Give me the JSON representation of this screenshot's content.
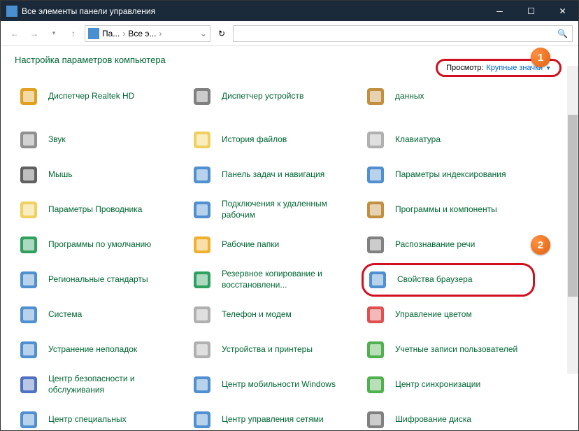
{
  "window": {
    "title": "Все элементы панели управления"
  },
  "breadcrumb": {
    "p1": "Па...",
    "p2": "Все э..."
  },
  "header": {
    "title": "Настройка параметров компьютера"
  },
  "viewby": {
    "label": "Просмотр:",
    "value": "Крупные значки"
  },
  "badges": {
    "one": "1",
    "two": "2"
  },
  "items": [
    {
      "label": "Диспетчер Realtek HD",
      "c": "#e0a020"
    },
    {
      "label": "Диспетчер устройств",
      "c": "#808080"
    },
    {
      "label": "данных",
      "c": "#c09040"
    },
    {
      "label": "Звук",
      "c": "#909090"
    },
    {
      "label": "История файлов",
      "c": "#f0d060"
    },
    {
      "label": "Клавиатура",
      "c": "#b0b0b0"
    },
    {
      "label": "Мышь",
      "c": "#606060"
    },
    {
      "label": "Панель задач и навигация",
      "c": "#5090d0"
    },
    {
      "label": "Параметры индексирования",
      "c": "#5090d0"
    },
    {
      "label": "Параметры Проводника",
      "c": "#f0d060"
    },
    {
      "label": "Подключения к удаленным рабочим",
      "c": "#5090d0"
    },
    {
      "label": "Программы и компоненты",
      "c": "#c09040"
    },
    {
      "label": "Программы по умолчанию",
      "c": "#30a060"
    },
    {
      "label": "Рабочие папки",
      "c": "#f0b030"
    },
    {
      "label": "Распознавание речи",
      "c": "#808080"
    },
    {
      "label": "Региональные стандарты",
      "c": "#5090d0"
    },
    {
      "label": "Резервное копирование и восстановлени...",
      "c": "#30a060"
    },
    {
      "label": "Свойства браузера",
      "c": "#5090d0",
      "callout": true
    },
    {
      "label": "Система",
      "c": "#5090d0"
    },
    {
      "label": "Телефон и модем",
      "c": "#b0b0b0"
    },
    {
      "label": "Управление цветом",
      "c": "#e05050"
    },
    {
      "label": "Устранение неполадок",
      "c": "#5090d0"
    },
    {
      "label": "Устройства и принтеры",
      "c": "#b0b0b0"
    },
    {
      "label": "Учетные записи пользователей",
      "c": "#50b050"
    },
    {
      "label": "Центр безопасности и обслуживания",
      "c": "#5070c0"
    },
    {
      "label": "Центр мобильности Windows",
      "c": "#5090d0"
    },
    {
      "label": "Центр синхронизации",
      "c": "#50b050"
    },
    {
      "label": "Центр специальных",
      "c": "#5090d0"
    },
    {
      "label": "Центр управления сетями",
      "c": "#5090d0"
    },
    {
      "label": "Шифрование диска",
      "c": "#808080"
    }
  ]
}
